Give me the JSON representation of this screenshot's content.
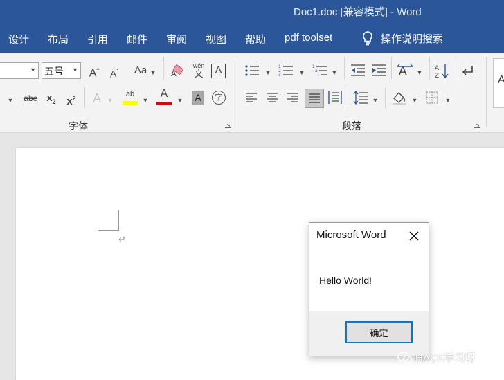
{
  "window": {
    "title": "Doc1.doc [兼容模式]  -  Word"
  },
  "menu": {
    "items": [
      "设计",
      "布局",
      "引用",
      "邮件",
      "审阅",
      "视图",
      "帮助",
      "pdf toolset"
    ],
    "tell_me": "操作说明搜索"
  },
  "ribbon": {
    "font_group_label": "字体",
    "paragraph_group_label": "段落",
    "font_size": "五号",
    "font_buttons": {
      "grow": "A",
      "shrink": "A",
      "change_case": "Aa",
      "phonetic_top": "wén",
      "phonetic_bottom": "文",
      "char_border": "A",
      "strikethrough": "abc",
      "subscript": "x",
      "subscript_mark": "2",
      "superscript": "x",
      "superscript_mark": "2",
      "text_effects": "A",
      "highlight": "ab",
      "font_color": "A",
      "char_shading": "A",
      "enclose": "字"
    },
    "highlight_color": "#ffff00",
    "font_color_bar": "#e00000"
  },
  "document": {
    "paragraph_mark": "↵"
  },
  "dialog": {
    "title": "Microsoft Word",
    "message": "Hello World!",
    "ok_label": "确定"
  },
  "watermark": {
    "text": "HACK学习呀"
  },
  "colors": {
    "accent": "#2b579a",
    "ok_border": "#0078d7"
  }
}
